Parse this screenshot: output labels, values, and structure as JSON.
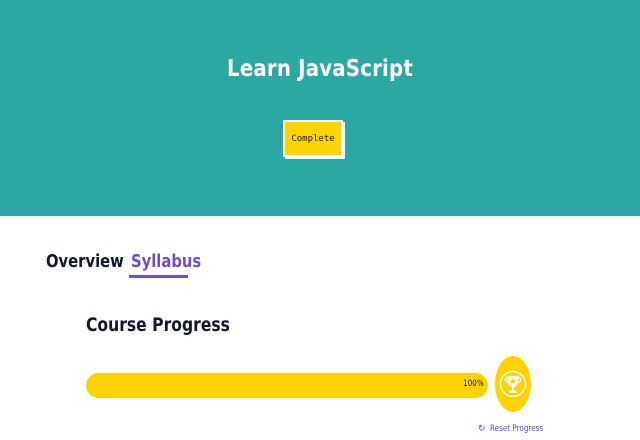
{
  "hero": {
    "title": "Learn JavaScript",
    "button_label": "Complete"
  },
  "tabs": [
    {
      "label": "Overview",
      "active": false
    },
    {
      "label": "Syllabus",
      "active": true
    }
  ],
  "progress": {
    "title": "Course Progress",
    "percent_label": "100%",
    "fraction": 1.0,
    "reset_label": "Reset Progress",
    "trophy_icon": "trophy-icon",
    "reset_icon": "refresh-icon"
  },
  "colors": {
    "hero_background": "#2ca8a4",
    "accent_yellow": "#ffd300",
    "active_tab": "#6e4fc9",
    "link_blue": "#4a4df0",
    "text_dark": "#10162f"
  }
}
